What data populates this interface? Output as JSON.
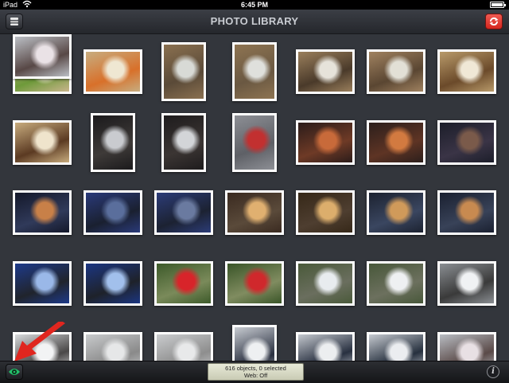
{
  "status_bar": {
    "carrier": "iPad",
    "time": "6:45 PM"
  },
  "nav": {
    "title": "PHOTO LIBRARY",
    "left_icon": "stack-menu-icon",
    "right_icon": "refresh-icon",
    "right_color": "#d6261e"
  },
  "bottom": {
    "status_line1": "616 objects, 0 selected",
    "status_line2": "Web: Off",
    "eye_icon": "eye-icon",
    "info_label": "i",
    "eye_color": "#22c06a"
  },
  "annotation": {
    "arrow_color": "#e0261f"
  },
  "photos": [
    {
      "name": "photo-food-plate-1",
      "colors": [
        "#c9b48c",
        "#e8e0c8",
        "#6e9a3a"
      ],
      "portrait": false
    },
    {
      "name": "photo-food-plate-2",
      "colors": [
        "#c7ad80",
        "#efe7d2",
        "#d8702a"
      ],
      "portrait": false
    },
    {
      "name": "photo-water-glass-1",
      "colors": [
        "#8a7050",
        "#d8dad6",
        "#5a4a38"
      ],
      "portrait": true
    },
    {
      "name": "photo-water-glass-2",
      "colors": [
        "#8e7452",
        "#dfe0dc",
        "#6a5842"
      ],
      "portrait": true
    },
    {
      "name": "photo-glass-chopsticks-1",
      "colors": [
        "#9a7f5c",
        "#e6e3da",
        "#4a3a2a"
      ],
      "portrait": false
    },
    {
      "name": "photo-glass-chopsticks-2",
      "colors": [
        "#a08260",
        "#e2e0d6",
        "#5a4632"
      ],
      "portrait": false
    },
    {
      "name": "photo-sake-cup",
      "colors": [
        "#b89a6a",
        "#f0e8d6",
        "#6b4a2a"
      ],
      "portrait": false
    },
    {
      "name": "photo-chopsticks-plate",
      "colors": [
        "#c8ac7e",
        "#efe4cc",
        "#5b3a22"
      ],
      "portrait": false
    },
    {
      "name": "photo-dark-window-1",
      "colors": [
        "#1b1a1c",
        "#c9cbcf",
        "#3e3a38"
      ],
      "portrait": true
    },
    {
      "name": "photo-dark-window-2",
      "colors": [
        "#1e1c1d",
        "#d3d5d8",
        "#3b3533"
      ],
      "portrait": true
    },
    {
      "name": "photo-torii-gate",
      "colors": [
        "#8d8f95",
        "#c23030",
        "#5e6066"
      ],
      "portrait": true
    },
    {
      "name": "photo-night-street-1",
      "colors": [
        "#2b1c1a",
        "#c86a3a",
        "#6e3a26"
      ],
      "portrait": false
    },
    {
      "name": "photo-night-street-2",
      "colors": [
        "#2c1f1c",
        "#d27a40",
        "#5e3424"
      ],
      "portrait": false
    },
    {
      "name": "photo-night-street-3",
      "colors": [
        "#1c1e2a",
        "#7a5a4a",
        "#3a3446"
      ],
      "portrait": false
    },
    {
      "name": "photo-night-crossing",
      "colors": [
        "#14182a",
        "#c88048",
        "#303a5a"
      ],
      "portrait": false
    },
    {
      "name": "photo-dusk-plaza-1",
      "colors": [
        "#2a3a7a",
        "#5a6e9c",
        "#1a2030"
      ],
      "portrait": false
    },
    {
      "name": "photo-dusk-plaza-2",
      "colors": [
        "#2c3c78",
        "#6a7aa0",
        "#1c2232"
      ],
      "portrait": false
    },
    {
      "name": "photo-lit-station-1",
      "colors": [
        "#3a2a20",
        "#e0b070",
        "#5a4a3a"
      ],
      "portrait": false
    },
    {
      "name": "photo-lit-station-2",
      "colors": [
        "#362818",
        "#dcae6c",
        "#4e3e30"
      ],
      "portrait": false
    },
    {
      "name": "photo-night-parking-1",
      "colors": [
        "#1c2230",
        "#d09a5a",
        "#3a4660"
      ],
      "portrait": false
    },
    {
      "name": "photo-night-parking-2",
      "colors": [
        "#1a2030",
        "#c88a50",
        "#384258"
      ],
      "portrait": false
    },
    {
      "name": "photo-blue-building-1",
      "colors": [
        "#1e3a8a",
        "#9ab8e8",
        "#20242c"
      ],
      "portrait": false
    },
    {
      "name": "photo-blue-building-2",
      "colors": [
        "#1c3682",
        "#a2c0ec",
        "#1e222a"
      ],
      "portrait": false
    },
    {
      "name": "photo-red-camellia-1",
      "colors": [
        "#3d5a2a",
        "#d8242a",
        "#7a8a5a"
      ],
      "portrait": false
    },
    {
      "name": "photo-red-camellia-2",
      "colors": [
        "#3a5528",
        "#d0282c",
        "#808c60"
      ],
      "portrait": false
    },
    {
      "name": "photo-snow-stone-1",
      "colors": [
        "#4a5a3a",
        "#e8ecef",
        "#6a6e5e"
      ],
      "portrait": false
    },
    {
      "name": "photo-snow-stone-2",
      "colors": [
        "#48583a",
        "#eef0f2",
        "#6c705e"
      ],
      "portrait": false
    },
    {
      "name": "photo-snow-roof",
      "colors": [
        "#8a8e92",
        "#f0f2f4",
        "#3a3a3a"
      ],
      "portrait": false
    },
    {
      "name": "photo-bare-branches",
      "colors": [
        "#d8dadc",
        "#f2f3f4",
        "#4a4848"
      ],
      "portrait": false
    },
    {
      "name": "photo-white-sky-1",
      "colors": [
        "#c8cacc",
        "#e6e7e8",
        "#8a8a8a"
      ],
      "portrait": false
    },
    {
      "name": "photo-white-sky-2",
      "colors": [
        "#caccce",
        "#e8e9ea",
        "#8e8e8e"
      ],
      "portrait": false
    },
    {
      "name": "photo-temple-roof-1",
      "colors": [
        "#c8ccd2",
        "#eef0f2",
        "#2a3040"
      ],
      "portrait": true
    },
    {
      "name": "photo-temple-roof-2",
      "colors": [
        "#c4c8ce",
        "#eceef0",
        "#283040"
      ],
      "portrait": false
    },
    {
      "name": "photo-temple-roof-3",
      "colors": [
        "#c6cad0",
        "#ebedf0",
        "#26303e"
      ],
      "portrait": false
    },
    {
      "name": "photo-plum-blossom-1",
      "colors": [
        "#b8bcc2",
        "#e8e0e4",
        "#5a4a48"
      ],
      "portrait": false
    },
    {
      "name": "photo-plum-blossom-2",
      "colors": [
        "#bcc0c6",
        "#eae2e6",
        "#584846"
      ],
      "portrait": false
    }
  ]
}
